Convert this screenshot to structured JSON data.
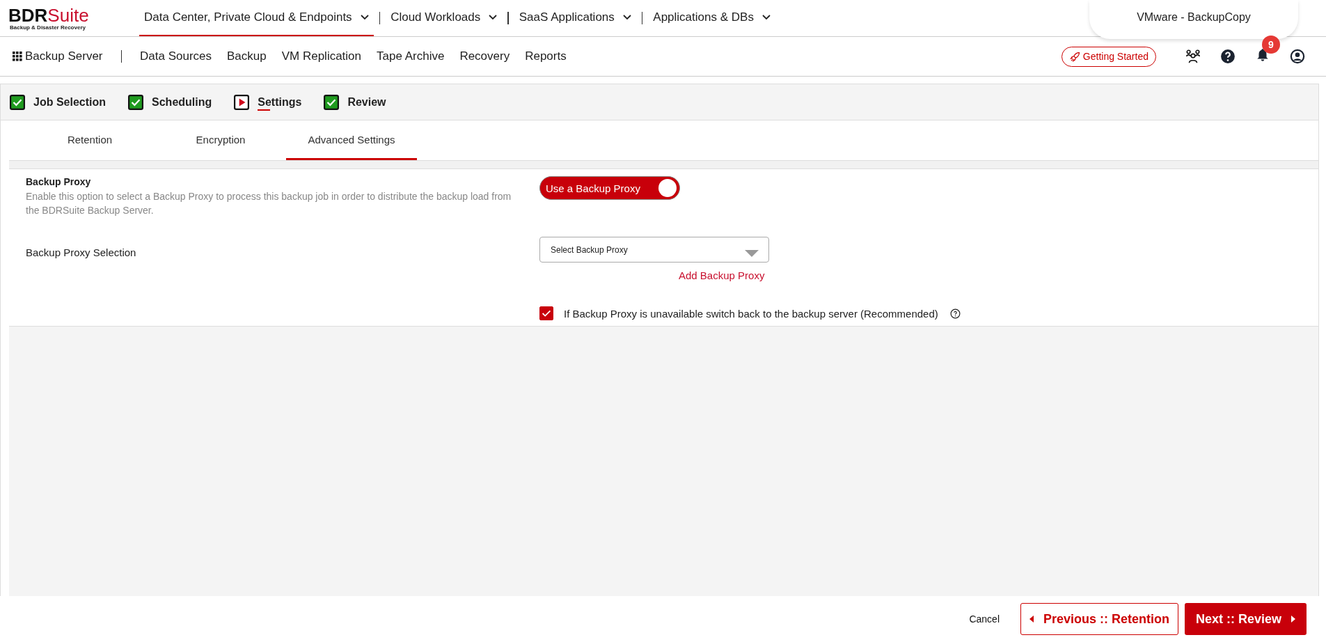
{
  "logo": {
    "primary": "BDR",
    "accent": "Suite",
    "tagline": "Backup & Disaster Recovery"
  },
  "top_nav": [
    {
      "label": "Data Center, Private Cloud & Endpoints",
      "selected": true
    },
    {
      "label": "Cloud Workloads",
      "selected": false
    },
    {
      "label": "SaaS Applications",
      "selected": false
    },
    {
      "label": "Applications & DBs",
      "selected": false
    }
  ],
  "job_title": "VMware - BackupCopy",
  "app_name": "Backup Server",
  "main_nav": [
    "Data Sources",
    "Backup",
    "VM Replication",
    "Tape Archive",
    "Recovery",
    "Reports"
  ],
  "getting_started": "Getting Started",
  "notification_count": "9",
  "steps": [
    {
      "label": "Job Selection",
      "kind": "done",
      "selected": false
    },
    {
      "label": "Scheduling",
      "kind": "done",
      "selected": false
    },
    {
      "label": "Settings",
      "kind": "current",
      "selected": true
    },
    {
      "label": "Review",
      "kind": "done",
      "selected": false
    }
  ],
  "tabs": [
    {
      "label": "Retention",
      "selected": false
    },
    {
      "label": "Encryption",
      "selected": false
    },
    {
      "label": "Advanced Settings",
      "selected": true
    }
  ],
  "section": {
    "title": "Backup Proxy",
    "description": "Enable this option to select a Backup Proxy to process this backup job in order to distribute the backup load from the BDRSuite Backup Server."
  },
  "toggle": {
    "label": "Use a Backup Proxy",
    "on": true
  },
  "proxy_selection": {
    "label": "Backup Proxy Selection",
    "placeholder": "Select Backup Proxy",
    "link": "Add Backup Proxy"
  },
  "fallback": {
    "label": "If Backup Proxy is unavailable switch back to the backup server (Recommended)",
    "checked": true
  },
  "footer": {
    "cancel": "Cancel",
    "previous": "Previous :: Retention",
    "next": "Next :: Review"
  }
}
